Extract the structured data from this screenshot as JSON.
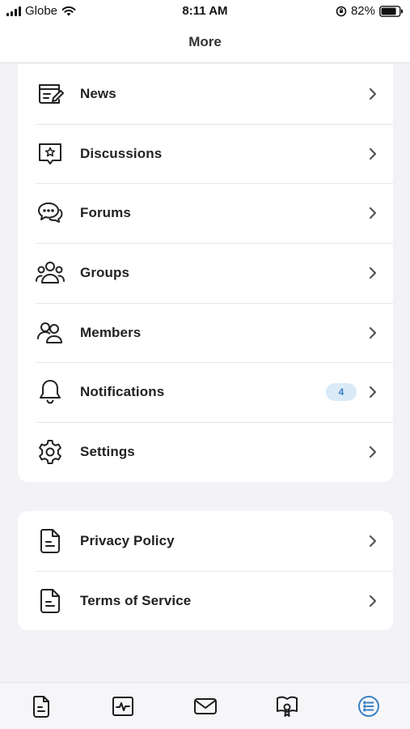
{
  "status_bar": {
    "carrier": "Globe",
    "time": "8:11 AM",
    "battery": "82%"
  },
  "header": {
    "title": "More"
  },
  "menu": {
    "items": [
      {
        "label": "News",
        "icon": "news-icon"
      },
      {
        "label": "Discussions",
        "icon": "discussion-icon"
      },
      {
        "label": "Forums",
        "icon": "forums-icon"
      },
      {
        "label": "Groups",
        "icon": "groups-icon"
      },
      {
        "label": "Members",
        "icon": "members-icon"
      },
      {
        "label": "Notifications",
        "icon": "bell-icon",
        "badge": "4"
      },
      {
        "label": "Settings",
        "icon": "gear-icon"
      }
    ]
  },
  "legal": {
    "items": [
      {
        "label": "Privacy Policy",
        "icon": "document-icon"
      },
      {
        "label": "Terms of Service",
        "icon": "document-icon"
      }
    ]
  },
  "tab_bar": {
    "tabs": [
      {
        "icon": "document-icon",
        "active": false
      },
      {
        "icon": "activity-icon",
        "active": false
      },
      {
        "icon": "mail-icon",
        "active": false
      },
      {
        "icon": "book-icon",
        "active": false
      },
      {
        "icon": "list-icon",
        "active": true
      }
    ],
    "active_color": "#3b82c4",
    "inactive_color": "#1d1d1f"
  }
}
